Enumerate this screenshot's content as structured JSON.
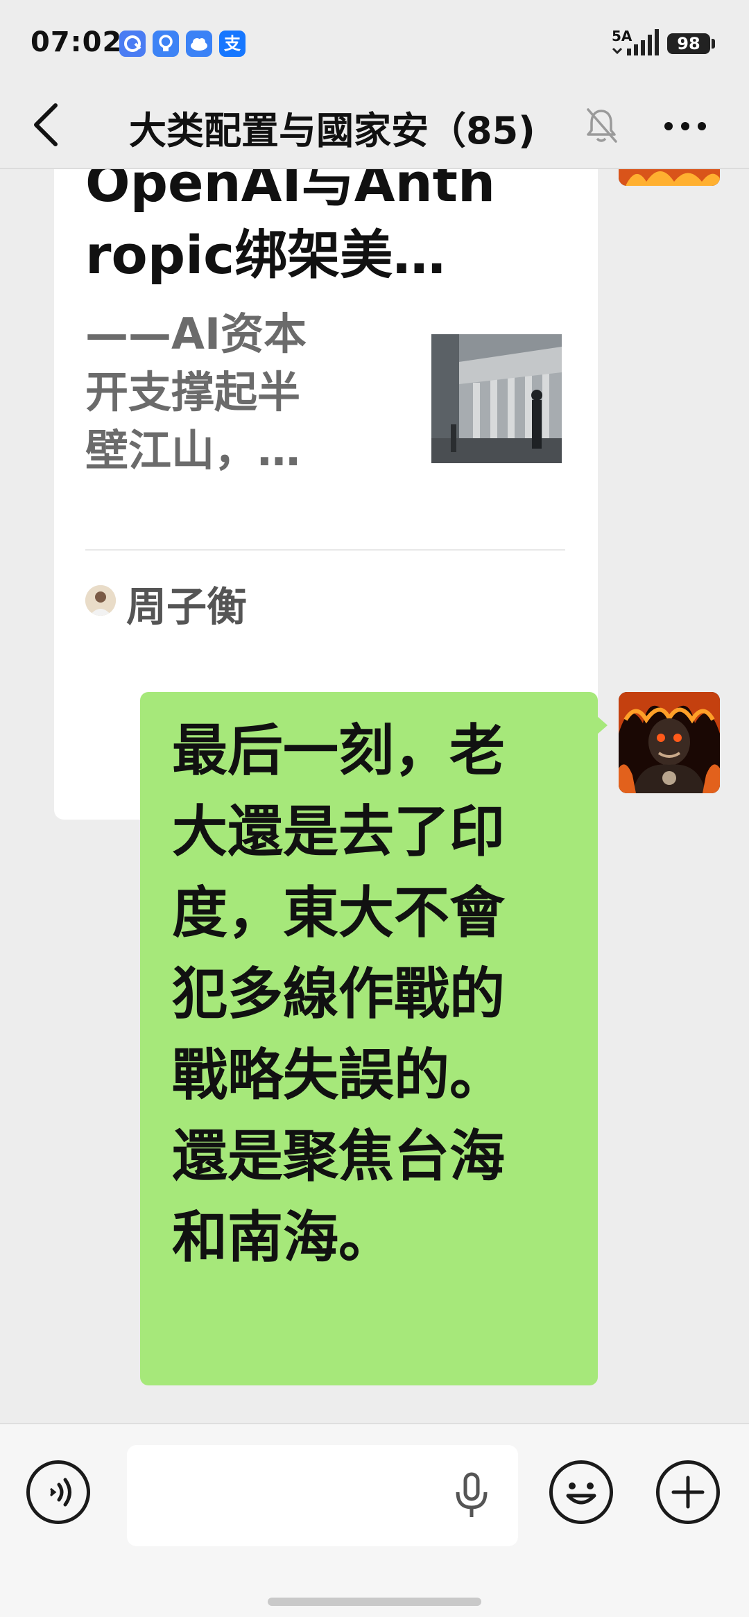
{
  "status_bar": {
    "time": "07:02",
    "app_icons": [
      {
        "name": "browser-app-icon",
        "glyph": "",
        "color": "#4a7cf3"
      },
      {
        "name": "bulb-app-icon",
        "glyph": "",
        "color": "#3d83f5"
      },
      {
        "name": "cloud-app-icon",
        "glyph": "",
        "color": "#3b82f6"
      },
      {
        "name": "alipay-app-icon",
        "glyph": "支",
        "color": "#1677ff"
      }
    ],
    "network": "5A",
    "battery": "98"
  },
  "nav": {
    "title": "大类配置与國家安（85)",
    "back_icon": "chevron-left-icon",
    "mute_icon": "bell-muted-icon",
    "more_icon": "more-dots-icon"
  },
  "article_card": {
    "title_lines": [
      "OpenAI与Anth",
      "ropic绑架美…"
    ],
    "summary_lines": [
      "——AI资本",
      "开支撑起半",
      "壁江山，…"
    ],
    "author": "周子衡"
  },
  "message": {
    "lines": [
      "最后一刻，老",
      "大還是去了印",
      "度，東大不會",
      "犯多線作戰的",
      "戰略失誤的。",
      "還是聚焦台海",
      "和南海。"
    ],
    "bubble_color": "#a6e87a"
  },
  "input_bar": {
    "voice_icon": "voice-mode-icon",
    "mic_icon": "microphone-icon",
    "emoji_icon": "emoji-icon",
    "plus_icon": "plus-icon",
    "placeholder": ""
  }
}
